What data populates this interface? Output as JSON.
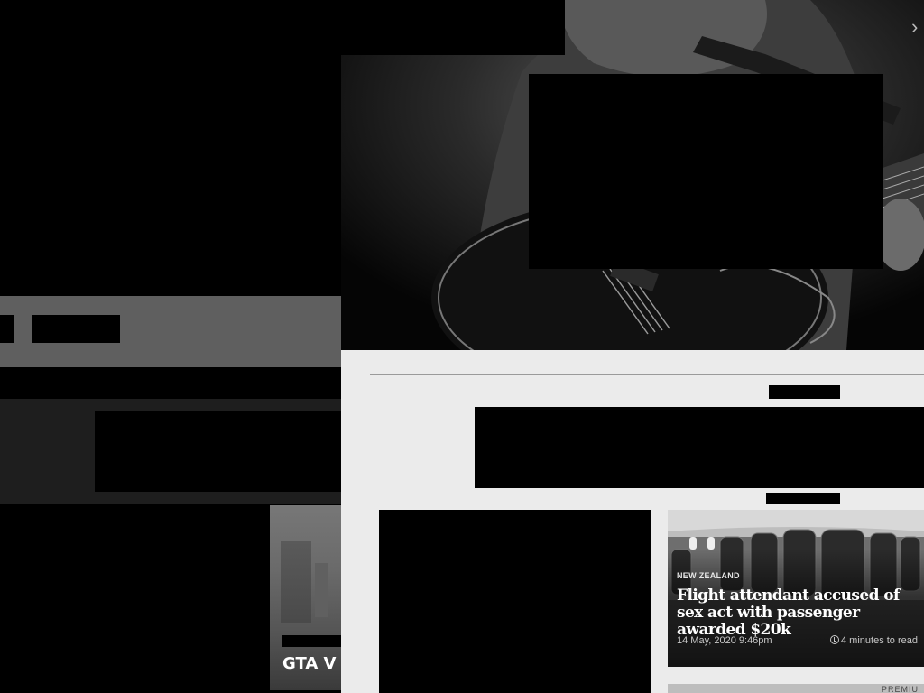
{
  "left_card": {
    "title": "GTA V is"
  },
  "news_card": {
    "category": "NEW ZEALAND",
    "headline": "Flight attendant accused of sex act with passenger awarded $20k",
    "date": "14 May, 2020 9:46pm",
    "read_time": "4 minutes to read",
    "icon": "clock-icon"
  },
  "next_card": {
    "badge": "PREMIU"
  },
  "hero": {
    "arrow": "›"
  }
}
